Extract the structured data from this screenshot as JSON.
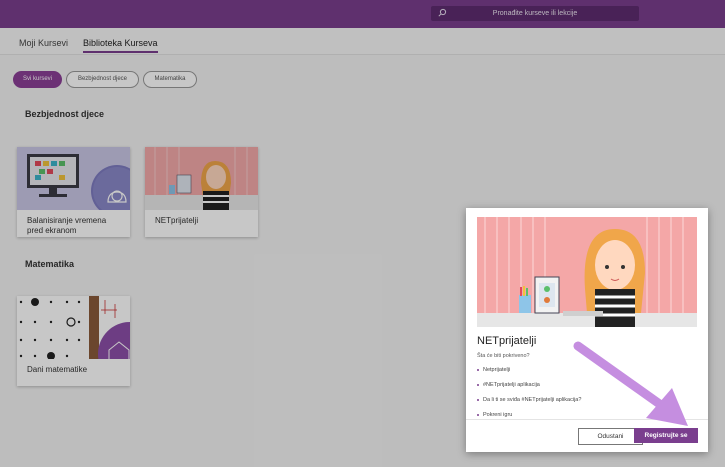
{
  "header": {
    "search_placeholder": "Pronađite kurseve ili lekcije"
  },
  "tabs": [
    {
      "label": "Moji Kursevi"
    },
    {
      "label": "Biblioteka Kurseva"
    }
  ],
  "filters": [
    {
      "label": "Svi kursevi",
      "active": true
    },
    {
      "label": "Bezbjednost djece",
      "active": false
    },
    {
      "label": "Matematika",
      "active": false
    }
  ],
  "sections": [
    {
      "title": "Bezbjednost djece",
      "courses": [
        {
          "title": "Balanisiranje vremena pred ekranom"
        },
        {
          "title": "NETprijatelji"
        }
      ]
    },
    {
      "title": "Matematika",
      "courses": [
        {
          "title": "Dani matematike"
        }
      ]
    }
  ],
  "dialog": {
    "title": "NETprijatelji",
    "question": "Šta će biti pokriveno?",
    "topics": [
      "Netprijatelji",
      "#NETprijatelji aplikacija",
      "Da li ti se sviđa #NETprijatelji aplikacija?",
      "Pokreni igru"
    ],
    "cancel_label": "Odustani",
    "register_label": "Registrujte se"
  },
  "colors": {
    "brand": "#7a3e8e",
    "annotation_arrow": "#c58ee0"
  }
}
